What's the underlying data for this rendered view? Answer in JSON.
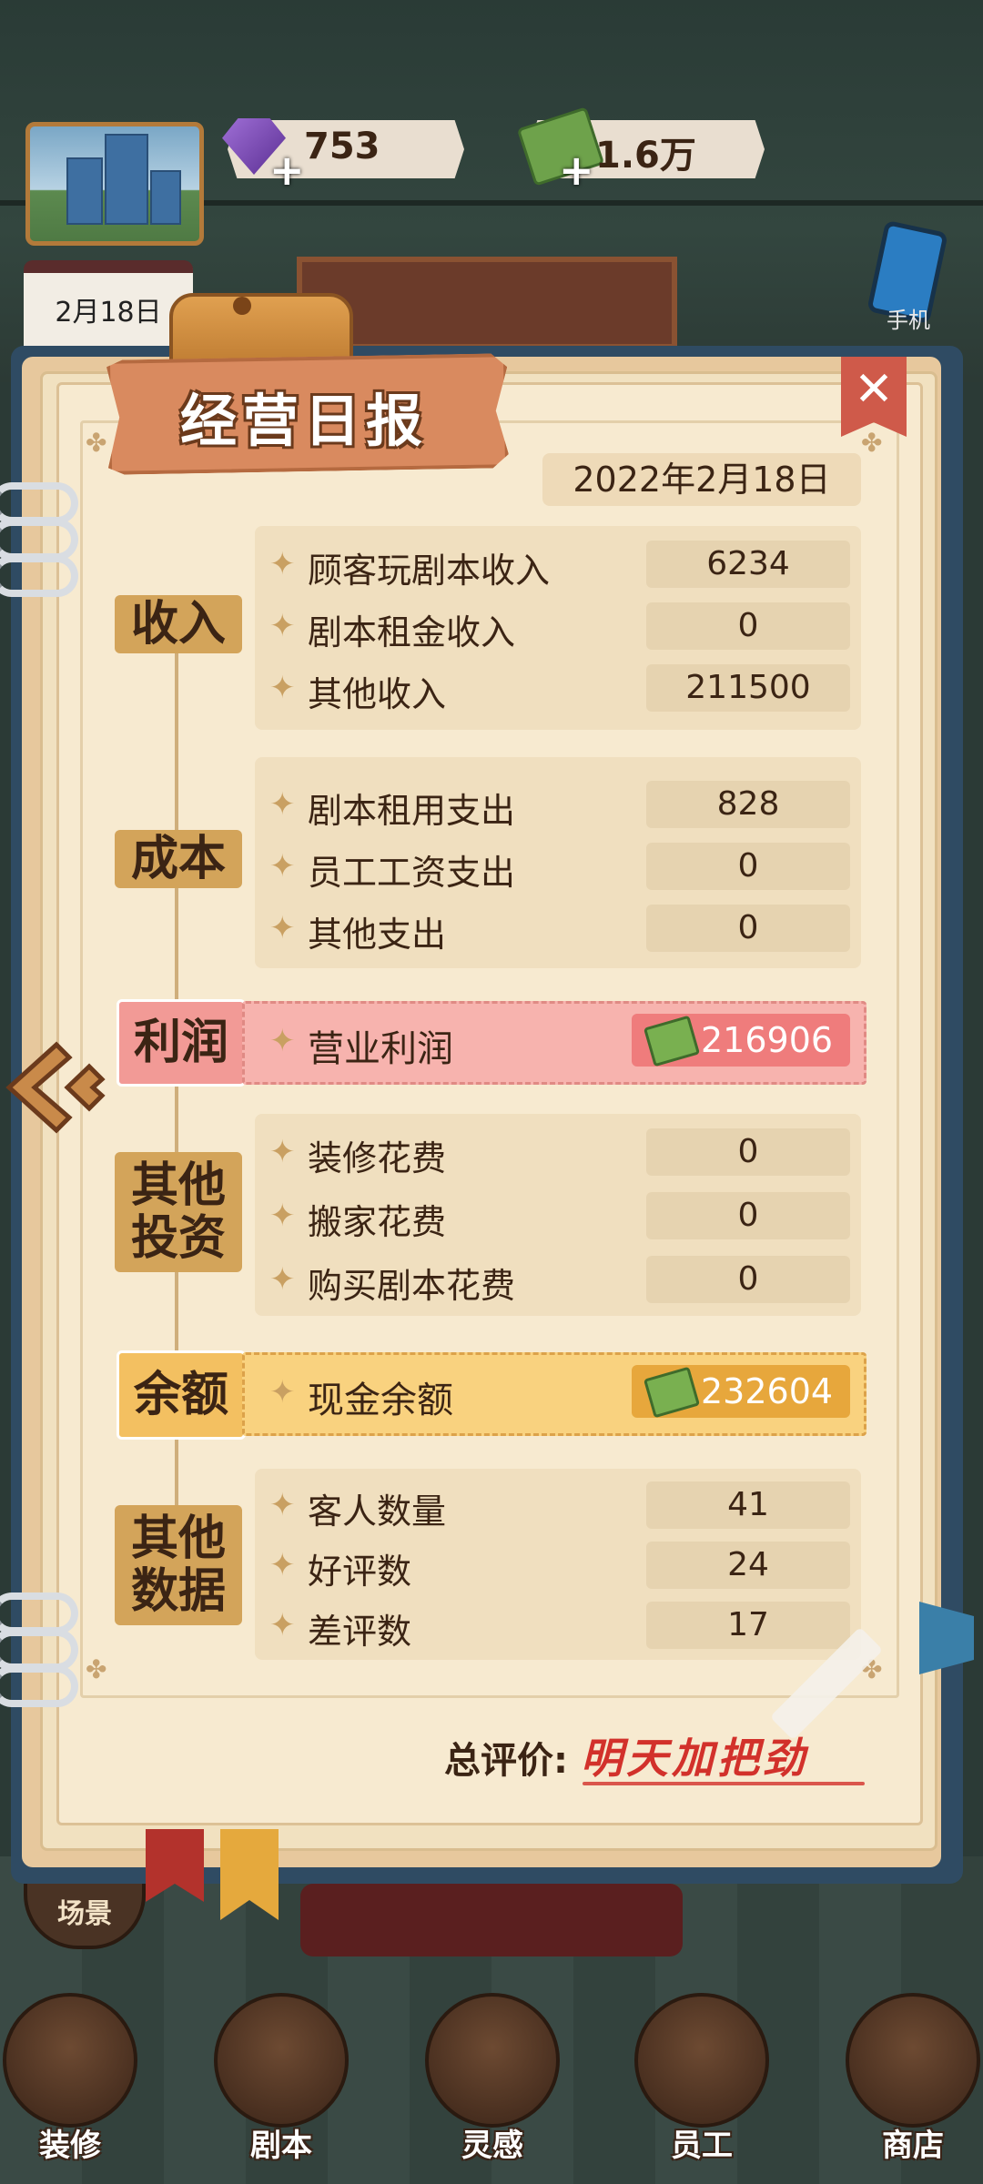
{
  "hud": {
    "gems": "753",
    "cash": "1.6万",
    "calendar_date": "2月18日",
    "phone_label": "手机"
  },
  "report": {
    "title": "经营日报",
    "close_icon": "close-x",
    "date": "2022年2月18日",
    "sections": {
      "income": {
        "label": "收入",
        "rows": [
          {
            "label": "顾客玩剧本收入",
            "value": "6234"
          },
          {
            "label": "剧本租金收入",
            "value": "0"
          },
          {
            "label": "其他收入",
            "value": "211500"
          }
        ]
      },
      "cost": {
        "label": "成本",
        "rows": [
          {
            "label": "剧本租用支出",
            "value": "828"
          },
          {
            "label": "员工工资支出",
            "value": "0"
          },
          {
            "label": "其他支出",
            "value": "0"
          }
        ]
      },
      "profit": {
        "label": "利润",
        "row_label": "营业利润",
        "value": "216906"
      },
      "investment": {
        "label_line1": "其他",
        "label_line2": "投资",
        "rows": [
          {
            "label": "装修花费",
            "value": "0"
          },
          {
            "label": "搬家花费",
            "value": "0"
          },
          {
            "label": "购买剧本花费",
            "value": "0"
          }
        ]
      },
      "balance": {
        "label": "余额",
        "row_label": "现金余额",
        "value": "232604"
      },
      "other_data": {
        "label_line1": "其他",
        "label_line2": "数据",
        "rows": [
          {
            "label": "客人数量",
            "value": "41"
          },
          {
            "label": "好评数",
            "value": "24"
          },
          {
            "label": "差评数",
            "value": "17"
          }
        ]
      }
    },
    "summary_label": "总评价:",
    "summary_value": "明天加把劲"
  },
  "scene_button": "场景",
  "nav": [
    {
      "label": "装修",
      "icon": "house-icon"
    },
    {
      "label": "剧本",
      "icon": "book-icon"
    },
    {
      "label": "灵感",
      "icon": "lightbulb-icon"
    },
    {
      "label": "员工",
      "icon": "badge-icon"
    },
    {
      "label": "商店",
      "icon": "shop-icon"
    }
  ],
  "colors": {
    "profit_pink": "#f7b3ae",
    "balance_gold": "#f9d27f",
    "summary_red": "#d2312b"
  }
}
